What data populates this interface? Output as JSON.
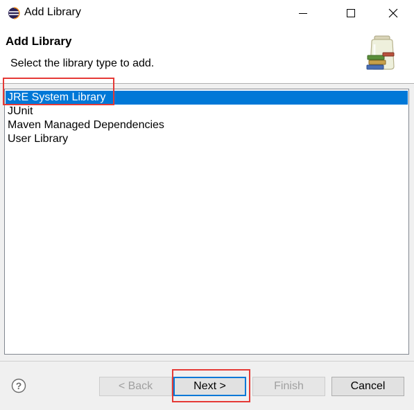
{
  "window": {
    "title": "Add Library"
  },
  "header": {
    "title": "Add Library",
    "description": "Select the library type to add."
  },
  "library_types": [
    {
      "label": "JRE System Library",
      "selected": true
    },
    {
      "label": "JUnit",
      "selected": false
    },
    {
      "label": "Maven Managed Dependencies",
      "selected": false
    },
    {
      "label": "User Library",
      "selected": false
    }
  ],
  "buttons": {
    "back": "< Back",
    "next": "Next >",
    "finish": "Finish",
    "cancel": "Cancel"
  },
  "colors": {
    "selection": "#0078d7",
    "annotation": "#e53935"
  },
  "icons": {
    "app": "eclipse-icon",
    "header": "library-jar-icon",
    "help": "help-icon"
  }
}
